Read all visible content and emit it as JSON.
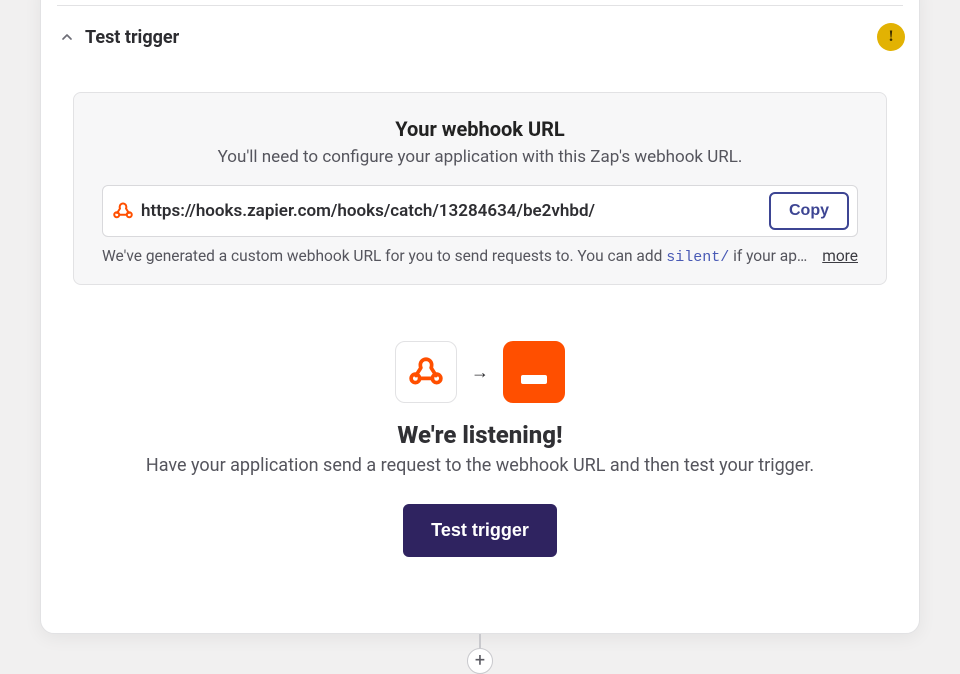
{
  "section": {
    "title": "Test trigger"
  },
  "status_badge": {
    "glyph": "!"
  },
  "webhook": {
    "title": "Your webhook URL",
    "subtitle": "You'll need to configure your application with this Zap's webhook URL.",
    "url": "https://hooks.zapier.com/hooks/catch/13284634/be2vhbd/",
    "copy_label": "Copy",
    "help_pre": "We've generated a custom webhook URL for you to send requests to. You can add ",
    "help_code": "silent/",
    "help_post": " if your applicatio…",
    "more_label": "more"
  },
  "listen": {
    "arrow": "→",
    "heading": "We're listening!",
    "subtitle": "Have your application send a request to the webhook URL and then test your trigger.",
    "button": "Test trigger"
  },
  "add_step": {
    "glyph": "+"
  }
}
